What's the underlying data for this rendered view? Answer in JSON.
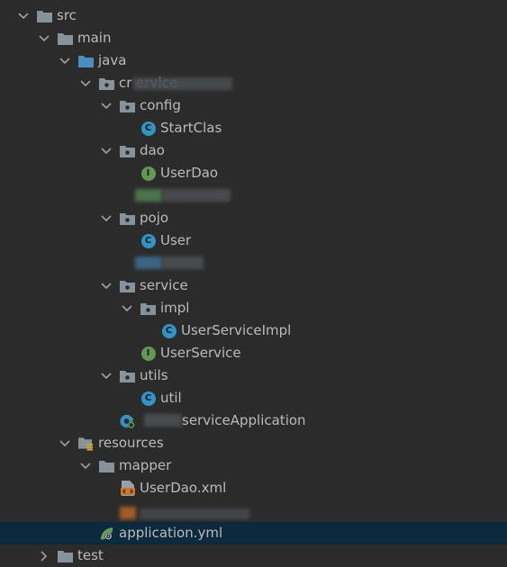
{
  "tree": {
    "src": "src",
    "main": "main",
    "java": "java",
    "package": "cr                ervice",
    "config": "config",
    "start_class": "StartClas",
    "dao": "dao",
    "user_dao": "UserDao",
    "pojo": "pojo",
    "user": "User",
    "service": "service",
    "impl": "impl",
    "user_service_impl": "UserServiceImpl",
    "user_service": "UserService",
    "utils": "utils",
    "util": "util",
    "application_class": "serviceApplication",
    "resources": "resources",
    "mapper": "mapper",
    "user_dao_xml": "UserDao.xml",
    "application_yml": "application.yml",
    "test": "test"
  },
  "badges": {
    "class": "C",
    "interface": "I"
  },
  "colors": {
    "background": "#2b2b2b",
    "selection": "#0d293e",
    "text": "#bbbbbb",
    "folder": "#87939a",
    "source_folder": "#4b8dbd",
    "class_badge": "#3592c4",
    "interface_badge": "#629755",
    "xml_icon": "#cc7832",
    "spring_green": "#6a9f51"
  }
}
